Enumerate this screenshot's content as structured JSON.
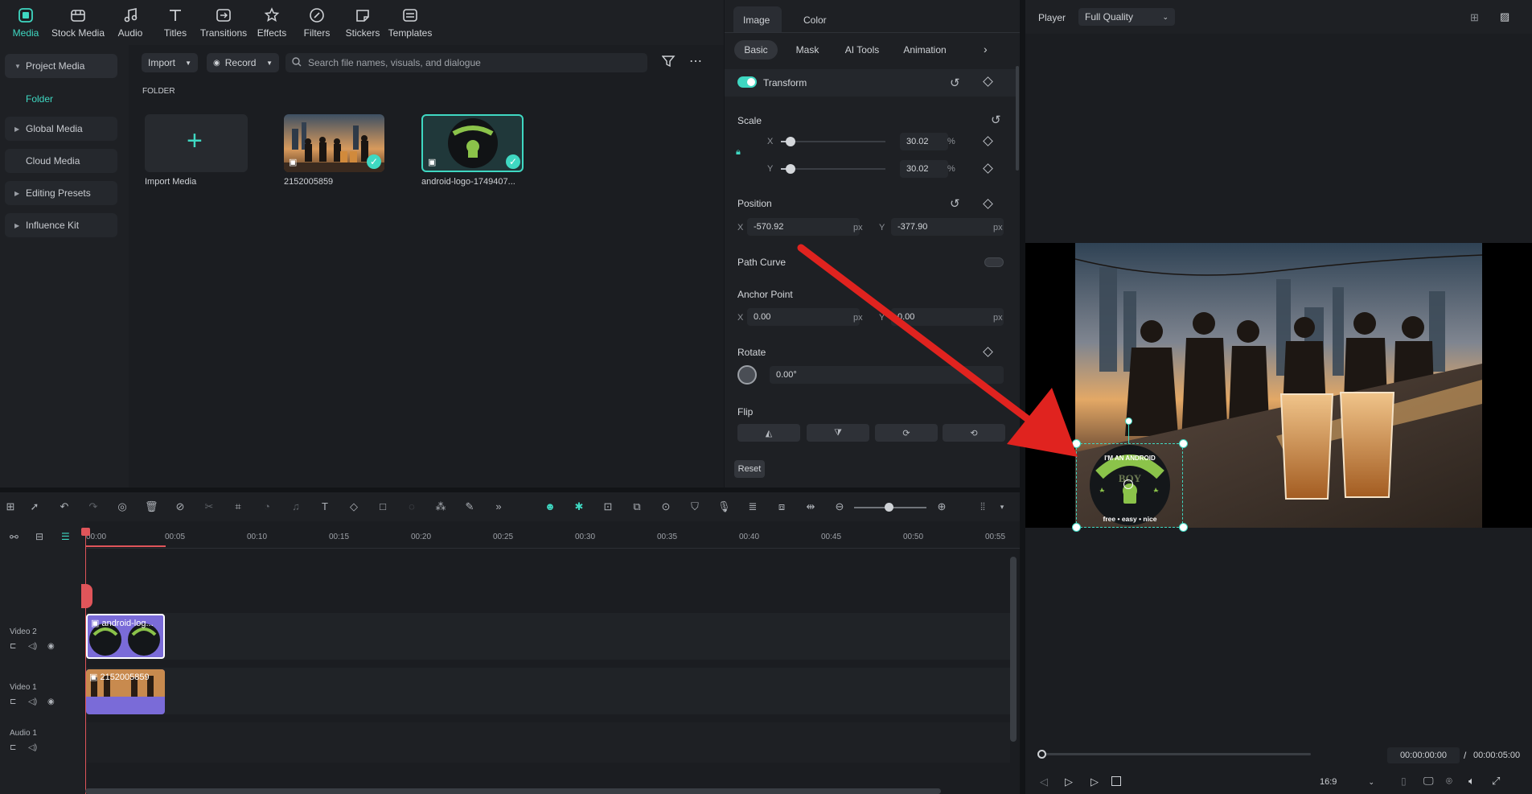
{
  "toolbar": {
    "items": [
      {
        "label": "Media",
        "icon": "media-icon"
      },
      {
        "label": "Stock Media",
        "icon": "stock-media-icon"
      },
      {
        "label": "Audio",
        "icon": "audio-icon"
      },
      {
        "label": "Titles",
        "icon": "titles-icon"
      },
      {
        "label": "Transitions",
        "icon": "transitions-icon"
      },
      {
        "label": "Effects",
        "icon": "effects-icon"
      },
      {
        "label": "Filters",
        "icon": "filters-icon"
      },
      {
        "label": "Stickers",
        "icon": "stickers-icon"
      },
      {
        "label": "Templates",
        "icon": "templates-icon"
      }
    ]
  },
  "sidebar": {
    "project_media": "Project Media",
    "folder": "Folder",
    "global_media": "Global Media",
    "cloud_media": "Cloud Media",
    "editing_presets": "Editing Presets",
    "influence_kit": "Influence Kit"
  },
  "media": {
    "import_label": "Import",
    "record_label": "Record",
    "search_placeholder": "Search file names, visuals, and dialogue",
    "folder_heading": "FOLDER",
    "import_media_label": "Import Media",
    "items": [
      {
        "name": "2152005859"
      },
      {
        "name": "android-logo-1749407..."
      }
    ]
  },
  "props": {
    "tabs": [
      "Image",
      "Color"
    ],
    "subtabs": [
      "Basic",
      "Mask",
      "AI Tools",
      "Animation"
    ],
    "transform_label": "Transform",
    "scale_label": "Scale",
    "scale_x": "30.02",
    "scale_y": "30.02",
    "scale_level": 0.3002,
    "percent": "%",
    "x_axis": "X",
    "y_axis": "Y",
    "position_label": "Position",
    "pos_x": "-570.92",
    "pos_y": "-377.90",
    "px": "px",
    "path_curve_label": "Path Curve",
    "anchor_label": "Anchor Point",
    "anchor_x": "0.00",
    "anchor_y": "0.00",
    "rotate_label": "Rotate",
    "rotate_value": "0.00°",
    "flip_label": "Flip",
    "reset_label": "Reset"
  },
  "player": {
    "label": "Player",
    "quality": "Full Quality",
    "current_time": "00:00:00:00",
    "separator": "/",
    "total_time": "00:00:05:00",
    "aspect": "16:9",
    "logo": {
      "top_text": "I'M AN ANDROID",
      "middle_text": "BOY",
      "bottom_text": "free • easy • nice"
    }
  },
  "timeline": {
    "ruler": [
      "00:00",
      "00:05",
      "00:10",
      "00:15",
      "00:20",
      "00:25",
      "00:30",
      "00:35",
      "00:40",
      "00:45",
      "00:50",
      "00:55"
    ],
    "tracks": [
      {
        "label": "Video 2",
        "clip": "android-log..."
      },
      {
        "label": "Video 1",
        "clip": "2152005859"
      },
      {
        "label": "Audio 1"
      }
    ]
  },
  "colors": {
    "accent": "#3fd8c2",
    "annotation_arrow": "#e0231f",
    "clip_purple": "#7a6bd8"
  }
}
